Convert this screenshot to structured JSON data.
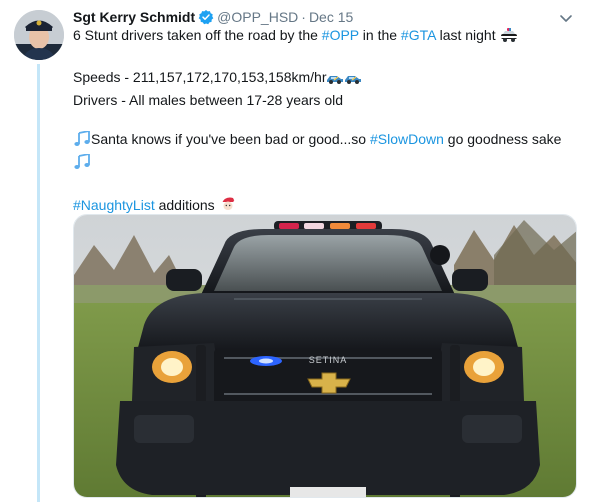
{
  "tweet": {
    "display_name": "Sgt Kerry Schmidt",
    "handle": "@OPP_HSD",
    "separator": "·",
    "date": "Dec 15",
    "line1_pre": "6 Stunt drivers taken off the road by the ",
    "line1_tag1": "#OPP",
    "line1_mid": " in the ",
    "line1_tag2": "#GTA",
    "line1_post": " last night",
    "speeds_line": "Speeds - 211,157,172,170,153,158km/hr",
    "drivers_line": "Drivers - All males between 17-28 years old",
    "santa_pre": "Santa knows if you've been bad or good...so ",
    "santa_tag": "#SlowDown",
    "santa_post": " go goodness sake",
    "naughty_tag": "#NaughtyList",
    "naughty_post": " additions",
    "icons": [
      "verified-badge-icon",
      "chevron-down-icon",
      "police-car-emoji",
      "racing-car-emoji",
      "music-notes-emoji",
      "santa-emoji"
    ]
  },
  "media": {
    "grille_badge_text": "SETINA"
  },
  "colors": {
    "hashtag": "#1b95e0",
    "verified": "#1da1f2",
    "thread_line": "#c4e6f8",
    "meta_text": "#657786"
  }
}
